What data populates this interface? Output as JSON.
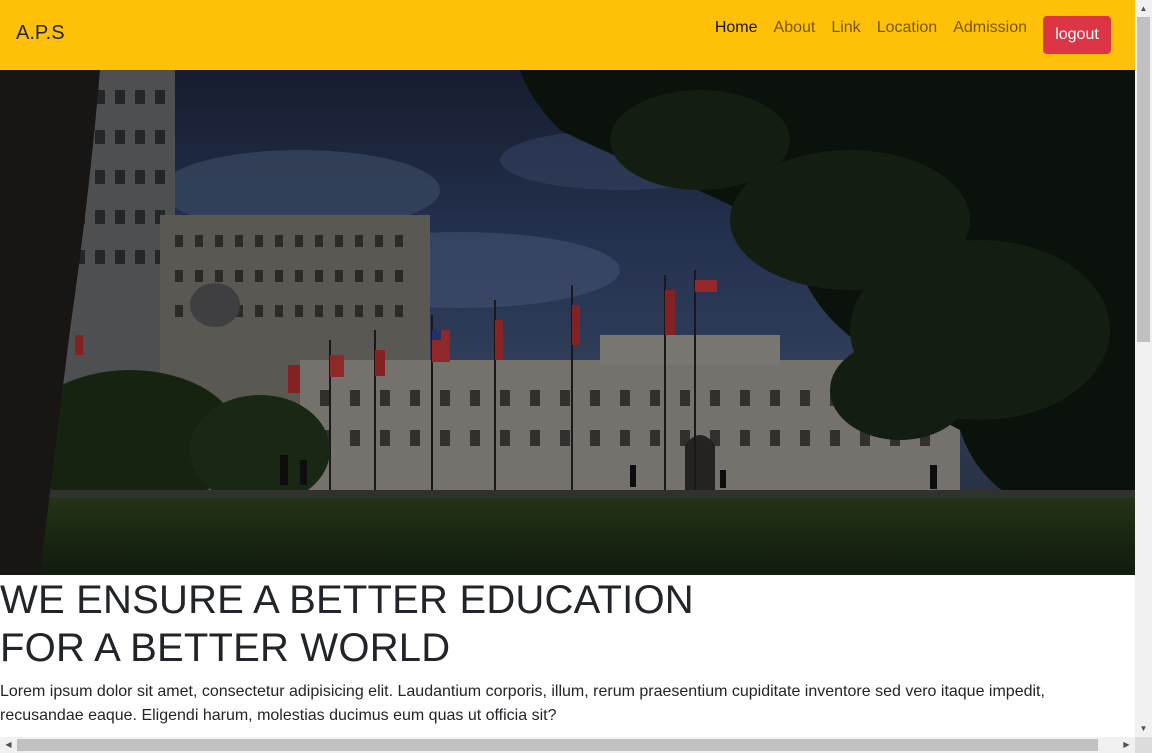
{
  "navbar": {
    "brand": "A.P.S",
    "links": [
      "Home",
      "About",
      "Link",
      "Location",
      "Admission"
    ],
    "active_link": "Home",
    "logout_label": "logout",
    "colors": {
      "background": "#ffc107",
      "logout": "#dc3545"
    }
  },
  "hero": {
    "image": "dark-overlay-photo-government-palace-with-flags"
  },
  "content": {
    "headline_line1": "WE ENSURE A BETTER EDUCATION",
    "headline_line2": "FOR A BETTER WORLD",
    "lead": "Lorem ipsum dolor sit amet, consectetur adipisicing elit. Laudantium corporis, illum, rerum praesentium cupiditate inventore sed vero itaque impedit, recusandae eaque. Eligendi harum, molestias ducimus eum quas ut officia sit?"
  },
  "scrollbars": {
    "vertical_up_icon": "triangle-up-icon",
    "vertical_down_icon": "triangle-down-icon",
    "horizontal_left_icon": "triangle-left-icon",
    "horizontal_right_icon": "triangle-right-icon"
  }
}
